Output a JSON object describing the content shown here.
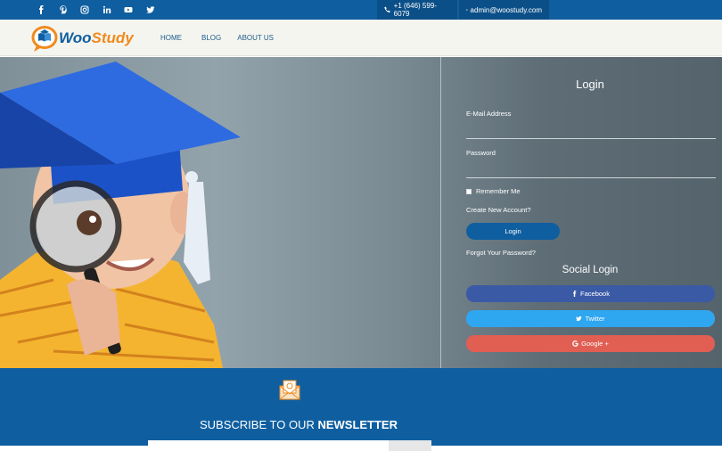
{
  "topbar": {
    "social_icons": [
      "facebook-icon",
      "pinterest-icon",
      "instagram-icon",
      "linkedin-icon",
      "youtube-icon",
      "twitter-icon"
    ],
    "phone": "+1 (646) 599-6079",
    "email": "admin@woostudy.com"
  },
  "brand": {
    "name_part1": "Woo",
    "name_part2": "Study"
  },
  "nav": {
    "home": "HOME",
    "blog": "BLOG",
    "about": "ABOUT US"
  },
  "login": {
    "title": "Login",
    "email_label": "E-Mail Address",
    "email_value": "",
    "password_label": "Password",
    "password_value": "",
    "remember": "Remember Me",
    "create_account": "Create New Account?",
    "login_button": "Login",
    "forgot": "Forgot Your Password?"
  },
  "social_login": {
    "title": "Social Login",
    "facebook": "Facebook",
    "twitter": "Twitter",
    "google": "Google +"
  },
  "newsletter": {
    "title_prefix": "SUBSCRIBE TO OUR ",
    "title_bold": "NEWSLETTER"
  },
  "colors": {
    "primary": "#0f5fa0",
    "accent": "#f08a1c",
    "facebook": "#3b5aa6",
    "twitter": "#2fa6f0",
    "google": "#e05e52"
  }
}
